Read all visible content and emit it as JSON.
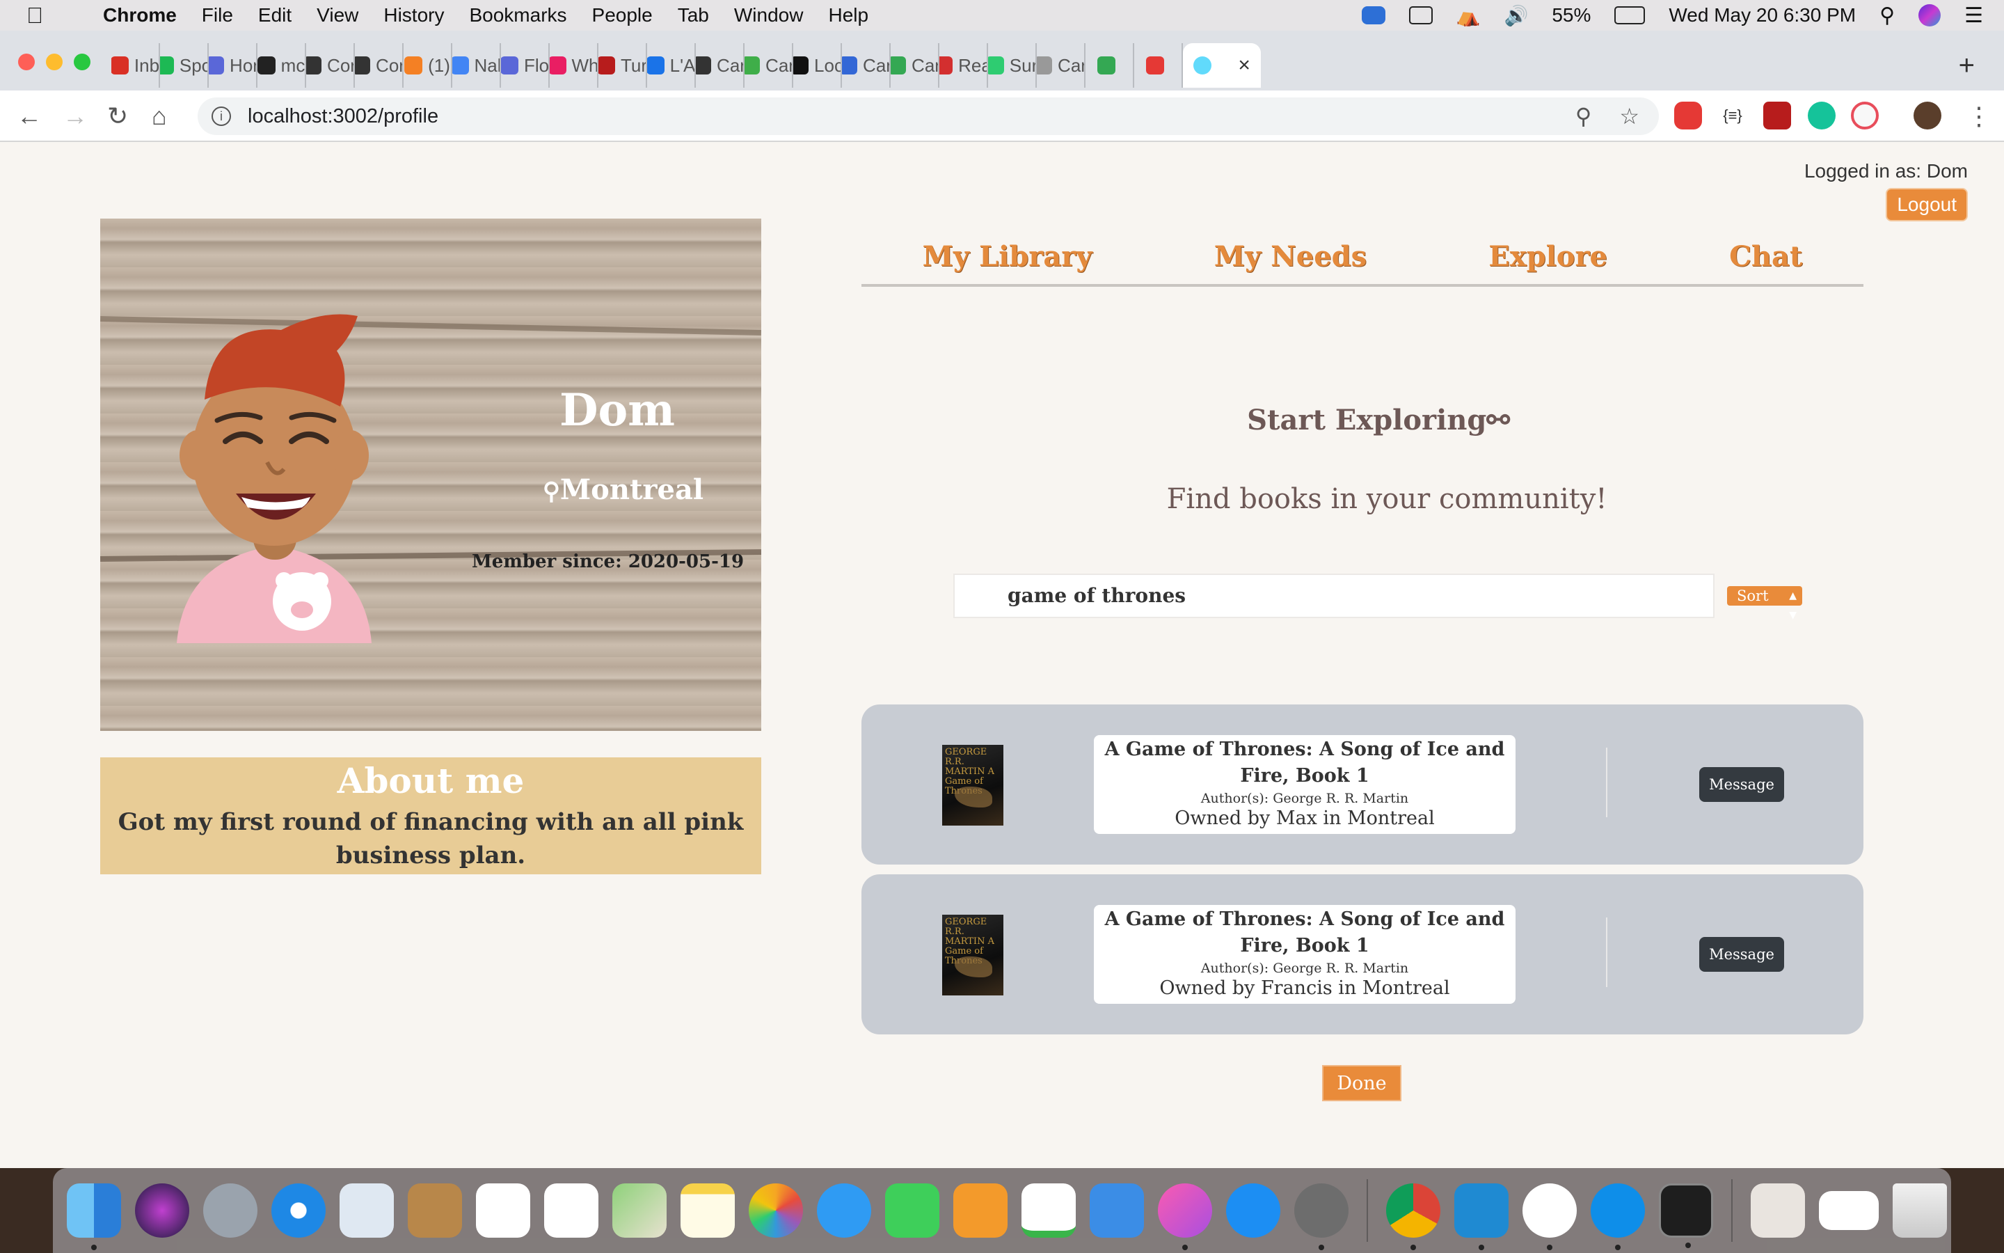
{
  "menubar": {
    "app": "Chrome",
    "items": [
      "File",
      "Edit",
      "View",
      "History",
      "Bookmarks",
      "People",
      "Tab",
      "Window",
      "Help"
    ],
    "battery": "55%",
    "clock": "Wed May 20  6:30 PM"
  },
  "tabs": [
    {
      "label": "Inb",
      "color": "#d93025"
    },
    {
      "label": "Spo",
      "color": "#1db954"
    },
    {
      "label": "Hor",
      "color": "#5a67d8"
    },
    {
      "label": "mc",
      "color": "#222222"
    },
    {
      "label": "Cor",
      "color": "#333333"
    },
    {
      "label": "Cor",
      "color": "#333333"
    },
    {
      "label": "(1)",
      "color": "#f48024"
    },
    {
      "label": "Nal",
      "color": "#4285f4"
    },
    {
      "label": "Flo",
      "color": "#5a67d8"
    },
    {
      "label": "Wh",
      "color": "#e91e63"
    },
    {
      "label": "Tur",
      "color": "#b71c1c"
    },
    {
      "label": "L'A",
      "color": "#1a73e8"
    },
    {
      "label": "Car",
      "color": "#333333"
    },
    {
      "label": "Car",
      "color": "#3fae49"
    },
    {
      "label": "Loc",
      "color": "#111111"
    },
    {
      "label": "Car",
      "color": "#3367d6"
    },
    {
      "label": "Car",
      "color": "#34a853"
    },
    {
      "label": "Rea",
      "color": "#d32f2f"
    },
    {
      "label": "Sur",
      "color": "#2ecc71"
    },
    {
      "label": "Car",
      "color": "#999999"
    },
    {
      "label": "",
      "color": "#34a853"
    },
    {
      "label": "",
      "color": "#e53935"
    }
  ],
  "active_tab_color": "#61dafb",
  "address": "localhost:3002/profile",
  "page": {
    "logged_in": "Logged in as: Dom",
    "logout": "Logout",
    "profile": {
      "name": "Dom",
      "location": "Montreal",
      "member_since": "Member since: 2020-05-19"
    },
    "about": {
      "title": "About me",
      "text": "Got my first round of financing with an all pink business plan."
    },
    "nav": [
      "My Library",
      "My Needs",
      "Explore",
      "Chat"
    ],
    "explore": {
      "title": "Start Exploring",
      "subtitle": "Find books in your community!",
      "search_value": "game of thrones",
      "sort_label": "Sort"
    },
    "results": [
      {
        "title": "A Game of Thrones: A Song of Ice and Fire, Book 1",
        "author": "Author(s): George R. R. Martin",
        "owner": "Owned by Max in Montreal",
        "cover_text": "GEORGE R.R. MARTIN A Game of Thrones",
        "button": "Message"
      },
      {
        "title": "A Game of Thrones: A Song of Ice and Fire, Book 1",
        "author": "Author(s): George R. R. Martin",
        "owner": "Owned by Francis in Montreal",
        "cover_text": "GEORGE R.R. MARTIN A Game of Thrones",
        "button": "Message"
      }
    ],
    "done": "Done"
  },
  "colors": {
    "accent": "#e98b3a",
    "page_bg": "#f8f5f1",
    "card_bg": "#c8ccd3",
    "about_bg": "#e8cc96",
    "heading": "#6d5856"
  }
}
